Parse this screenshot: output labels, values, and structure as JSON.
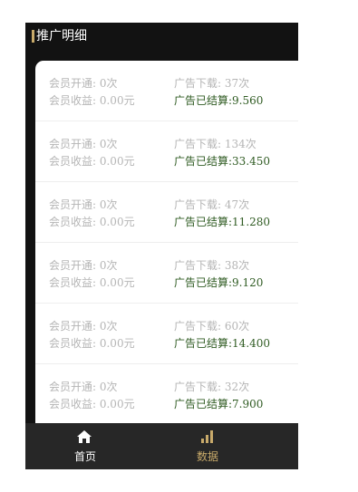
{
  "header": {
    "title": "推广明细"
  },
  "records": [
    {
      "member_open": "会员开通: 0次",
      "member_income": "会员收益: 0.00元",
      "ad_downloads": "广告下载: 37次",
      "ad_settled": "广告已结算:9.560"
    },
    {
      "member_open": "会员开通: 0次",
      "member_income": "会员收益: 0.00元",
      "ad_downloads": "广告下载: 134次",
      "ad_settled": "广告已结算:33.450"
    },
    {
      "member_open": "会员开通: 0次",
      "member_income": "会员收益: 0.00元",
      "ad_downloads": "广告下载: 47次",
      "ad_settled": "广告已结算:11.280"
    },
    {
      "member_open": "会员开通: 0次",
      "member_income": "会员收益: 0.00元",
      "ad_downloads": "广告下载: 38次",
      "ad_settled": "广告已结算:9.120"
    },
    {
      "member_open": "会员开通: 0次",
      "member_income": "会员收益: 0.00元",
      "ad_downloads": "广告下载: 60次",
      "ad_settled": "广告已结算:14.400"
    },
    {
      "member_open": "会员开通: 0次",
      "member_income": "会员收益: 0.00元",
      "ad_downloads": "广告下载: 32次",
      "ad_settled": "广告已结算:7.900"
    }
  ],
  "tabbar": {
    "tabs": [
      {
        "label": "首页",
        "icon": "home-icon",
        "active": false
      },
      {
        "label": "数据",
        "icon": "bar-chart-icon",
        "active": true
      }
    ]
  },
  "colors": {
    "accent": "#c8aa6a",
    "settled_text": "#2f5b22",
    "muted_text": "#b5b5b5",
    "header_bg": "#121212",
    "tabbar_bg": "#272727"
  }
}
